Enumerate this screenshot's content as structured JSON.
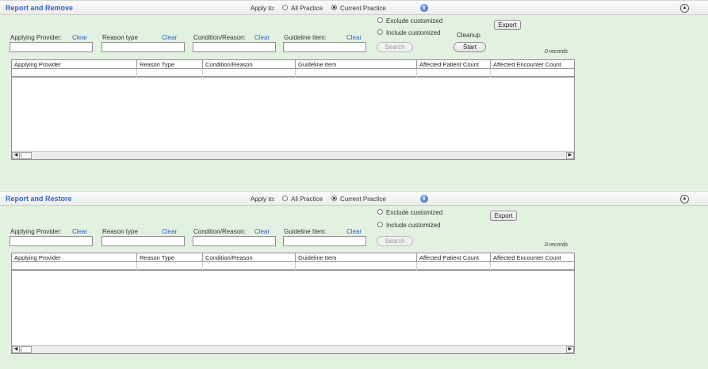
{
  "apply_to_label": "Apply to:",
  "apply_options": [
    "All Practice",
    "Current Practice"
  ],
  "info_icon_glyph": "i",
  "collapse_glyph": "▲",
  "filters": {
    "applying_provider": "Applying Provider:",
    "reason_type": "Reason type",
    "condition_reason": "Condition/Reason:",
    "guideline_item": "Guideline Item:",
    "clear": "Clear"
  },
  "customized_options": [
    "Exclude customized",
    "Include customized"
  ],
  "buttons": {
    "export": "Export",
    "search": "Search",
    "cleanup_label": "Cleanup",
    "start": "Start"
  },
  "records": "0 records",
  "columns": [
    "Applying Provider",
    "Reason Type",
    "Condition/Reason",
    "Guideline Item",
    "Affected Patient Count",
    "Affected Encounter Count"
  ],
  "scroll": {
    "left": "◀",
    "right": "▶"
  },
  "remove_panel": {
    "title": "Report and Remove"
  },
  "restore_panel": {
    "title": "Report and Restore"
  }
}
